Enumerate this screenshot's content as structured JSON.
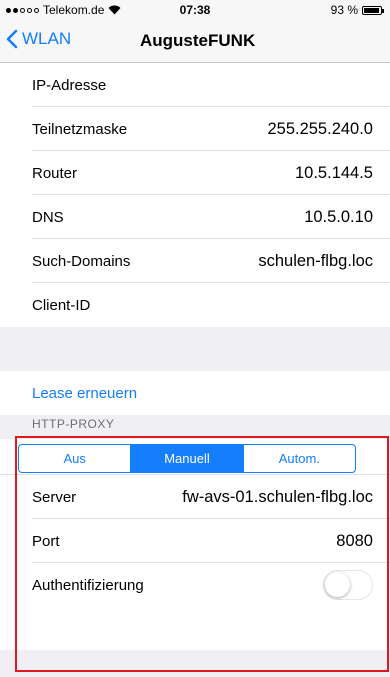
{
  "status": {
    "carrier": "Telekom.de",
    "time": "07:38",
    "battery": "93 %"
  },
  "nav": {
    "back_label": "WLAN",
    "title": "AugusteFUNK"
  },
  "ip_rows": [
    {
      "label": "IP-Adresse",
      "value": ""
    },
    {
      "label": "Teilnetzmaske",
      "value": "255.255.240.0"
    },
    {
      "label": "Router",
      "value": "10.5.144.5"
    },
    {
      "label": "DNS",
      "value": "10.5.0.10"
    },
    {
      "label": "Such-Domains",
      "value": "schulen-flbg.loc"
    },
    {
      "label": "Client-ID",
      "value": ""
    }
  ],
  "lease": {
    "label": "Lease erneuern"
  },
  "proxy": {
    "header": "HTTP-PROXY",
    "segments": [
      "Aus",
      "Manuell",
      "Autom."
    ],
    "selected": "Manuell",
    "server_label": "Server",
    "server_value": "fw-avs-01.schulen-flbg.loc",
    "port_label": "Port",
    "port_value": "8080",
    "auth_label": "Authentifizierung",
    "auth_enabled": false
  },
  "colors": {
    "accent": "#157efb",
    "highlight_box": "#e0181e"
  }
}
